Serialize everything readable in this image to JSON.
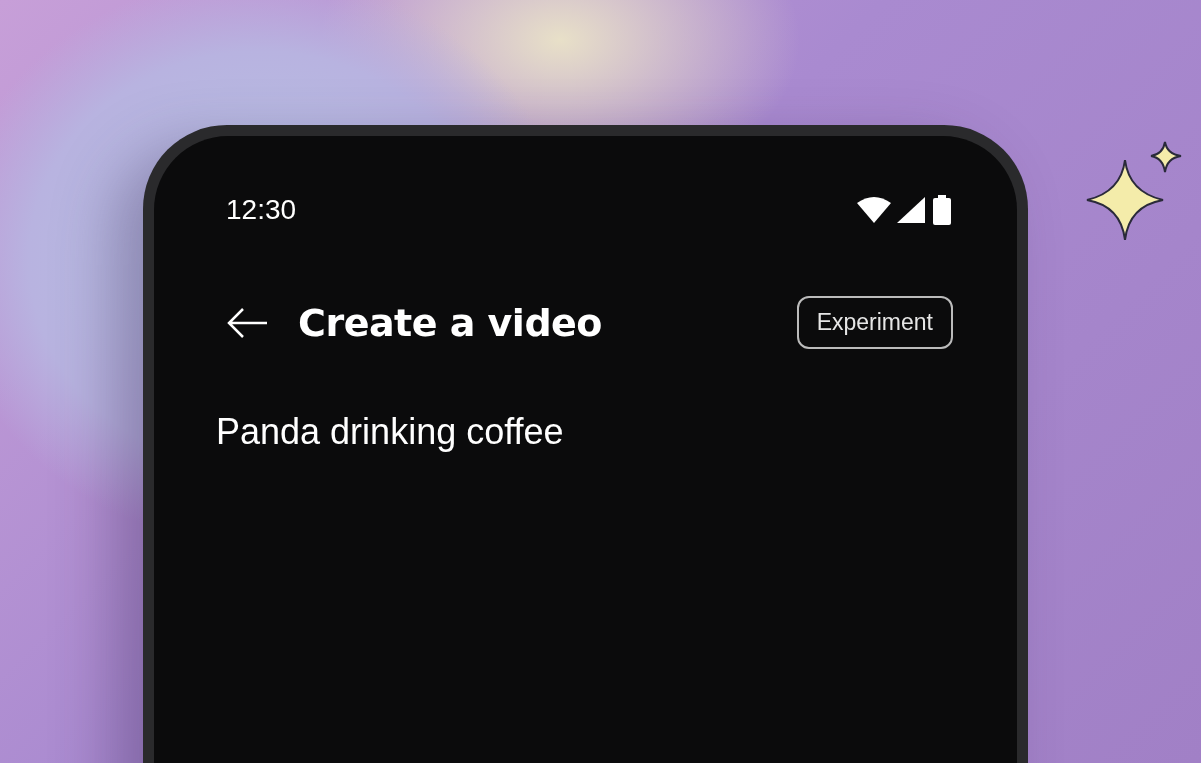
{
  "status_bar": {
    "time": "12:30"
  },
  "header": {
    "title": "Create a video",
    "badge": "Experiment"
  },
  "prompt": {
    "value": "Panda drinking coffee"
  }
}
